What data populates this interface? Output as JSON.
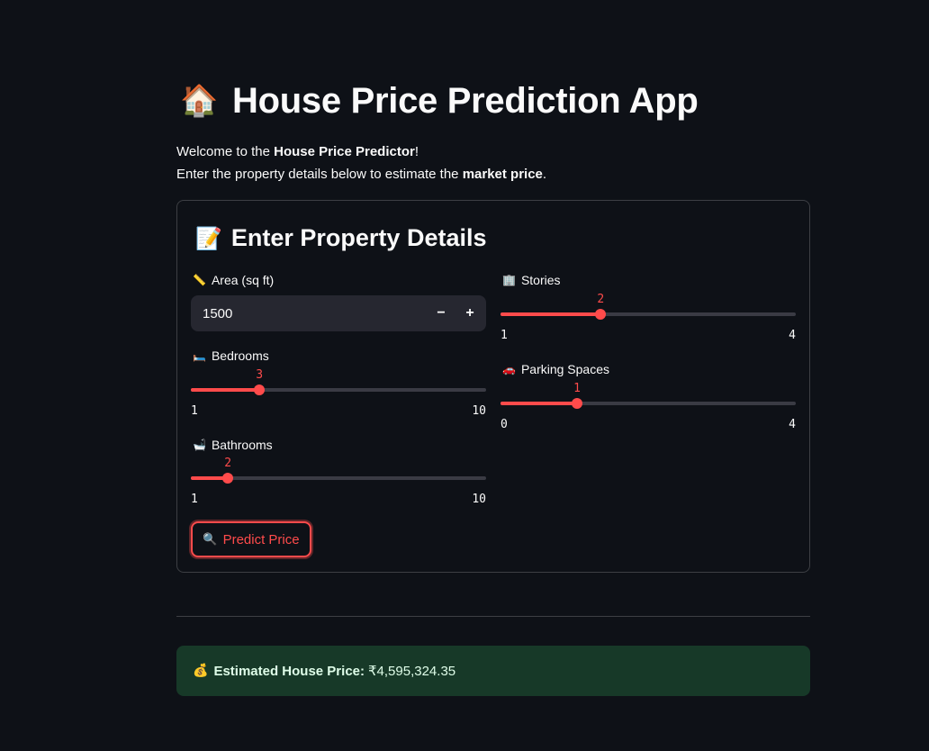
{
  "header": {
    "icon": "house-icon",
    "icon_glyph": "🏠",
    "title": "House Price Prediction App"
  },
  "intro": {
    "line1_prefix": "Welcome to the ",
    "line1_bold": "House Price Predictor",
    "line1_suffix": "!",
    "line2_prefix": "Enter the property details below to estimate the ",
    "line2_bold": "market price",
    "line2_suffix": "."
  },
  "form": {
    "heading_icon": "memo-icon",
    "heading_glyph": "📝",
    "heading": "Enter Property Details",
    "area": {
      "icon": "ruler-icon",
      "glyph": "📏",
      "label": "Area (sq ft)",
      "value": "1500",
      "decrement_label": "−",
      "increment_label": "+"
    },
    "bedrooms": {
      "icon": "bed-icon",
      "glyph": "🛏️",
      "label": "Bedrooms",
      "value": 3,
      "min": 1,
      "max": 10
    },
    "bathrooms": {
      "icon": "bathtub-icon",
      "glyph": "🛁",
      "label": "Bathrooms",
      "value": 2,
      "min": 1,
      "max": 10
    },
    "stories": {
      "icon": "building-icon",
      "glyph": "🏢",
      "label": "Stories",
      "value": 2,
      "min": 1,
      "max": 4
    },
    "parking": {
      "icon": "car-icon",
      "glyph": "🚗",
      "label": "Parking Spaces",
      "value": 1,
      "min": 0,
      "max": 4
    },
    "predict_button": {
      "icon": "magnifier-icon",
      "glyph": "🔍",
      "label": "Predict Price"
    }
  },
  "result": {
    "icon": "money-bag-icon",
    "glyph": "💰",
    "label": "Estimated House Price:",
    "value": "₹4,595,324.35"
  },
  "colors": {
    "accent": "#ff4b4b",
    "background": "#0e1117",
    "success_bg": "#173928"
  }
}
